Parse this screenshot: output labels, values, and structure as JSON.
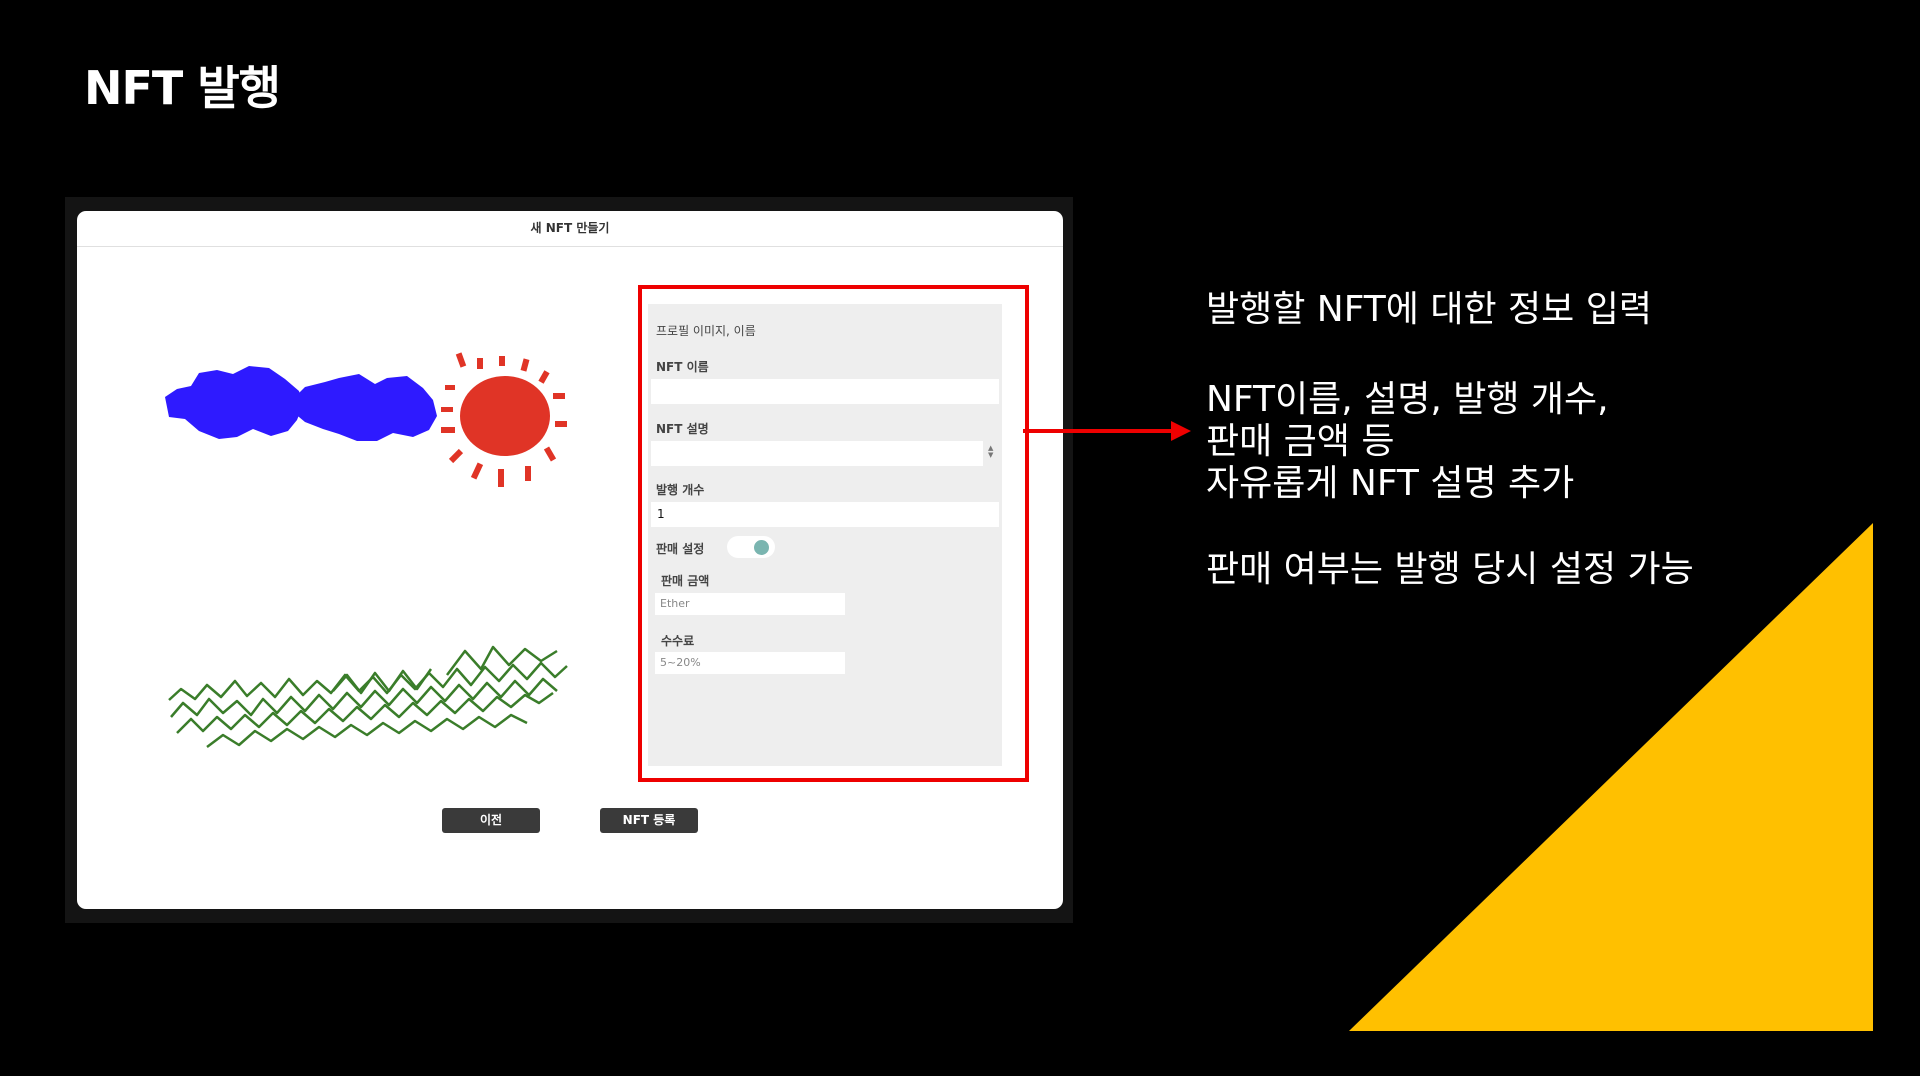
{
  "slide": {
    "title": "NFT 발행",
    "desc_heading": "발행할 NFT에 대한 정보 입력",
    "desc_lines": [
      "NFT이름, 설명, 발행 개수,",
      "판매 금액 등",
      "자유롭게 NFT 설명 추가"
    ],
    "desc_note": "판매 여부는 발행 당시 설정 가능",
    "accent_color": "#ffc000",
    "highlight_color": "#ee0000"
  },
  "dialog": {
    "title": "새 NFT 만들기",
    "form": {
      "section_label": "프로필 이미지, 이름",
      "name_label": "NFT 이름",
      "name_value": "",
      "desc_label": "NFT 설명",
      "desc_value": "",
      "count_label": "발행 개수",
      "count_value": "1",
      "sale_label": "판매 설정",
      "sale_enabled": true,
      "price_label": "판매 금액",
      "price_placeholder": "Ether",
      "fee_label": "수수료",
      "fee_placeholder": "5~20%"
    },
    "buttons": {
      "prev": "이전",
      "register": "NFT 등록"
    }
  }
}
